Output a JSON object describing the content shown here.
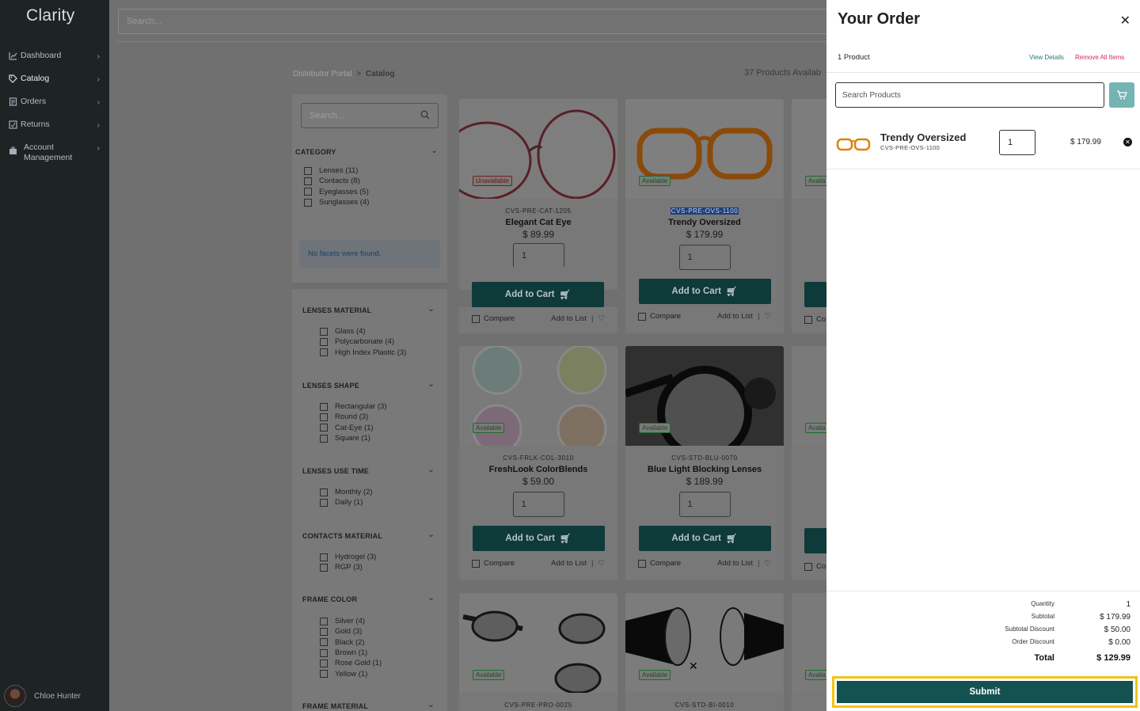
{
  "app": {
    "name": "Clarity"
  },
  "sidebar": {
    "items": [
      {
        "label": "Dashboard",
        "icon": "chart-icon"
      },
      {
        "label": "Catalog",
        "icon": "tag-icon"
      },
      {
        "label": "Orders",
        "icon": "orders-icon"
      },
      {
        "label": "Returns",
        "icon": "returns-icon"
      },
      {
        "label": "Account Management",
        "icon": "briefcase-icon"
      }
    ],
    "user": "Chloe Hunter"
  },
  "header": {
    "search_placeholder": "Search..."
  },
  "breadcrumb": {
    "root": "Distributor Portal",
    "separator": ">",
    "current": "Catalog"
  },
  "catalog": {
    "count_text": "37 Products Availab"
  },
  "filters": {
    "search_placeholder": "Search...",
    "category": {
      "title": "CATEGORY",
      "items": [
        {
          "name": "Lenses",
          "count": "(11)"
        },
        {
          "name": "Contacts",
          "count": "(8)"
        },
        {
          "name": "Eyeglasses",
          "count": "(5)"
        },
        {
          "name": "Sunglasses",
          "count": "(4)"
        }
      ]
    },
    "no_facets": "No facets were found.",
    "groups": [
      {
        "title": "LENSES MATERIAL",
        "items": [
          {
            "name": "Glass",
            "count": "(4)"
          },
          {
            "name": "Polycarbonate",
            "count": "(4)"
          },
          {
            "name": "High Index Plastic",
            "count": "(3)"
          }
        ]
      },
      {
        "title": "LENSES SHAPE",
        "items": [
          {
            "name": "Rectangular",
            "count": "(3)"
          },
          {
            "name": "Round",
            "count": "(3)"
          },
          {
            "name": "Cat-Eye",
            "count": "(1)"
          },
          {
            "name": "Square",
            "count": "(1)"
          }
        ]
      },
      {
        "title": "LENSES USE TIME",
        "items": [
          {
            "name": "Monthly",
            "count": "(2)"
          },
          {
            "name": "Daily",
            "count": "(1)"
          }
        ]
      },
      {
        "title": "CONTACTS MATERIAL",
        "items": [
          {
            "name": "Hydrogel",
            "count": "(3)"
          },
          {
            "name": "RGP",
            "count": "(3)"
          }
        ]
      },
      {
        "title": "FRAME COLOR",
        "items": [
          {
            "name": "Silver",
            "count": "(4)"
          },
          {
            "name": "Gold",
            "count": "(3)"
          },
          {
            "name": "Black",
            "count": "(2)"
          },
          {
            "name": "Brown",
            "count": "(1)"
          },
          {
            "name": "Rose Gold",
            "count": "(1)"
          },
          {
            "name": "Yellow",
            "count": "(1)"
          }
        ]
      },
      {
        "title": "FRAME MATERIAL",
        "items": []
      }
    ]
  },
  "products": [
    {
      "sku": "CVS-PRE-CAT-1205",
      "name": "Elegant Cat Eye",
      "price": "$ 89.99",
      "qty": "1",
      "status": "Unavailable"
    },
    {
      "sku": "CVS-PRE-OVS-1100",
      "name": "Trendy Oversized",
      "price": "$ 179.99",
      "qty": "1",
      "status": "Available"
    },
    {
      "sku": "CVS-FRLK-COL-3010",
      "name": "FreshLook ColorBlends",
      "price": "$ 59.00",
      "qty": "1",
      "status": "Available"
    },
    {
      "sku": "CVS-STD-BLU-0070",
      "name": "Blue Light Blocking Lenses",
      "price": "$ 189.99",
      "qty": "1",
      "status": "Available"
    },
    {
      "sku": "CVS-PRE-PRO-0025",
      "status": "Available"
    },
    {
      "sku": "CVS-STD-BI-0010",
      "status": "Available"
    }
  ],
  "card_labels": {
    "add_to_cart": "Add to Cart",
    "compare": "Compare",
    "add_to_list": "Add to List",
    "available": "Availa",
    "compare_short": "Co"
  },
  "order": {
    "title": "Your Order",
    "count": "1 Product",
    "view_details": "View Details",
    "remove_all": "Remove All Items",
    "search_placeholder": "Search Products",
    "line": {
      "name": "Trendy Oversized",
      "sku": "CVS-PRE-OVS-1100",
      "qty": "1",
      "price": "$ 179.99"
    },
    "summary": {
      "quantity_label": "Quantity",
      "quantity": "1",
      "subtotal_label": "Subtotal",
      "subtotal": "$ 179.99",
      "subtotal_discount_label": "Subtotal Discount",
      "subtotal_discount": "$ 50.00",
      "order_discount_label": "Order Discount",
      "order_discount": "$ 0.00",
      "total_label": "Total",
      "total": "$ 129.99"
    },
    "submit": "Submit"
  },
  "colors": {
    "accent": "#145252",
    "highlight": "#f2c315",
    "link": "#1f7a7a",
    "danger": "#d0285a"
  }
}
